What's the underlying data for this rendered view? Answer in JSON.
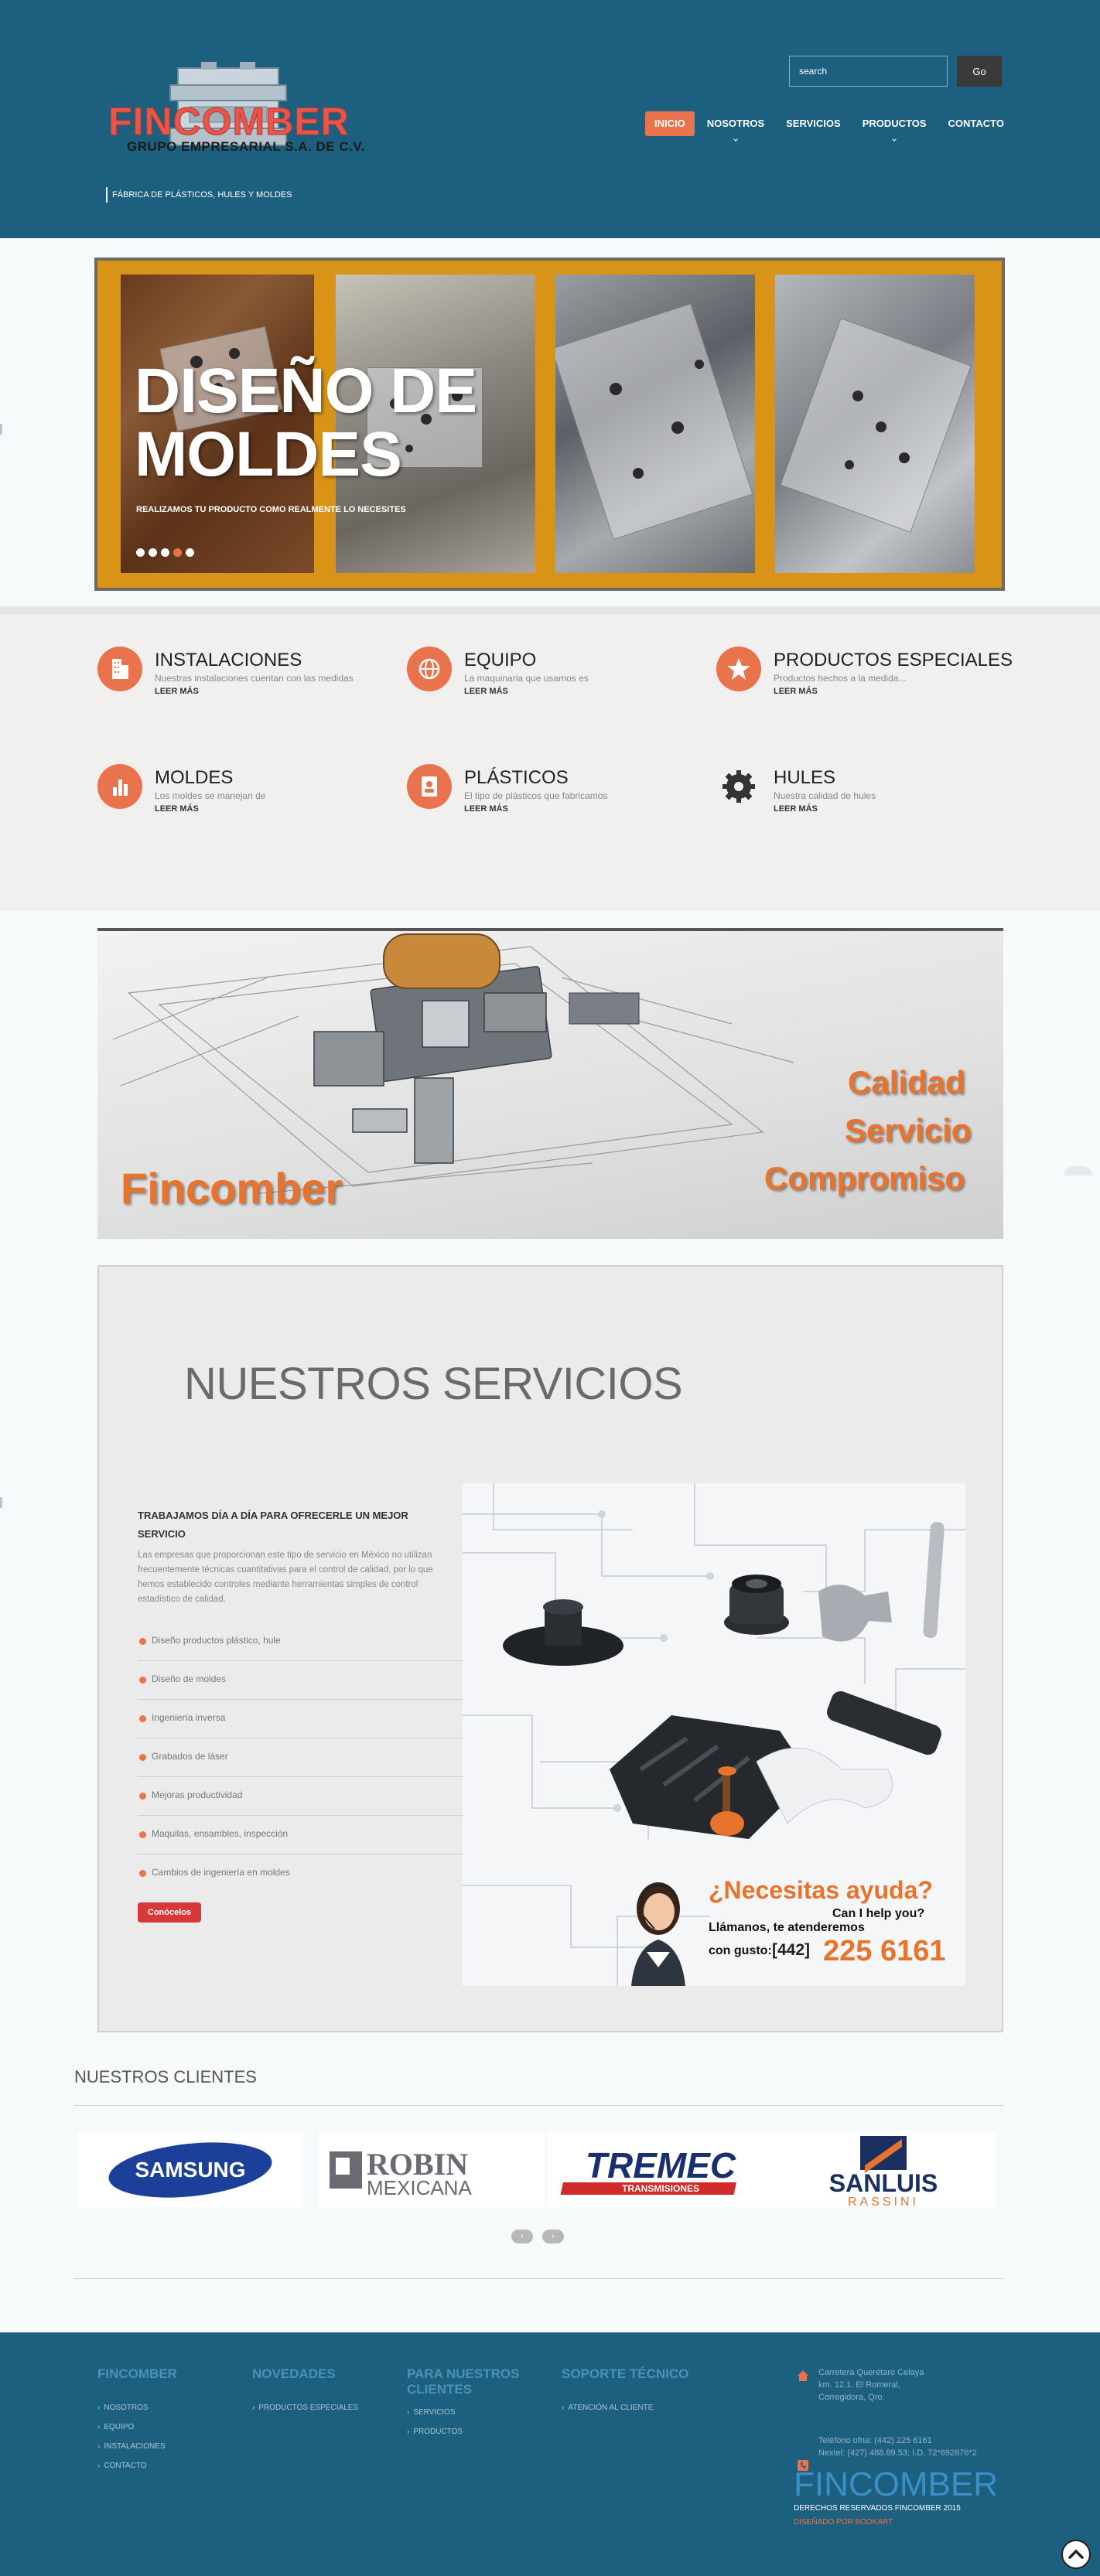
{
  "header": {
    "logo_text": "FINCOMBER",
    "logo_sub": "GRUPO EMPRESARIAL S.A. DE C.V.",
    "tagline": "FÁBRICA DE PLÁSTICOS, HULES Y MOLDES",
    "search": {
      "placeholder": "search",
      "value": "search"
    },
    "go_label": "Go",
    "nav": [
      {
        "label": "INICIO",
        "active": true
      },
      {
        "label": "NOSOTROS",
        "dropdown": true
      },
      {
        "label": "SERVICIOS"
      },
      {
        "label": "PRODUCTOS",
        "dropdown": true
      },
      {
        "label": "CONTACTO"
      }
    ]
  },
  "slider": {
    "title_line1": "DISEÑO DE",
    "title_line2": "MOLDES",
    "subtitle": "REALIZAMOS TU PRODUCTO COMO REALMENTE LO NECESITES",
    "dot_count": 5,
    "active_dot": 3
  },
  "features": [
    {
      "title": "INSTALACIONES",
      "desc": "Nuestras instalaciones cuentan con las medidas",
      "more": "LEER MÁS",
      "icon": "building-icon"
    },
    {
      "title": "EQUIPO",
      "desc": "La maquinaria que usamos es",
      "more": "LEER MÁS",
      "icon": "globe-icon"
    },
    {
      "title": "PRODUCTOS ESPECIALES",
      "desc": "Productos hechos a la medida...",
      "more": "LEER MÁS",
      "icon": "star-icon"
    },
    {
      "title": "MOLDES",
      "desc": "Los moldes se manejan de",
      "more": "LEER MÁS",
      "icon": "bar-chart-icon"
    },
    {
      "title": "PLÁSTICOS",
      "desc": "El tipo de plásticos que fabricamos",
      "more": "LEER MÁS",
      "icon": "address-book-icon"
    },
    {
      "title": "HULES",
      "desc": "Nuestra calidad de hules",
      "more": "LEER MÁS",
      "icon": "gear-icon"
    }
  ],
  "banner": {
    "brand": "Fincomber",
    "words": [
      "Calidad",
      "Servicio",
      "Compromiso"
    ]
  },
  "services": {
    "title": "NUESTROS SERVICIOS",
    "intro_head": "TRABAJAMOS DÍA A DÍA PARA OFRECERLE UN MEJOR SERVICIO",
    "intro": "Las empresas que proporcionan este tipo de servicio en México no utilizan frecuentemente técnicas cuantitativas para el control de calidad, por lo que hemos establecido controles mediante herramientas simples de control estadístico de calidad.",
    "items": [
      "Diseño productos plástico, hule",
      "Diseño de moldes",
      "Ingeniería inversa",
      "Grabados de láser",
      "Mejoras productividad",
      "Maquilas, ensambles, inspección",
      "Cambios de ingeniería en moldes"
    ],
    "button": "Conócelos",
    "ad": {
      "title": "¿Necesitas ayuda?",
      "english": "Can I help you?",
      "line1": "Llámanos, te atenderemos",
      "line2": "con gusto:",
      "code": "[442]",
      "number": "225 6161"
    }
  },
  "clients": {
    "title": "NUESTROS CLIENTES",
    "logos": [
      {
        "name": "SAMSUNG"
      },
      {
        "name": "ROBIN",
        "sub": "MEXICANA"
      },
      {
        "name": "TREMEC",
        "sub": "TRANSMISIONES"
      },
      {
        "name": "SANLUIS",
        "sub": "RASSINI"
      }
    ],
    "prev": "‹",
    "next": "›"
  },
  "footer": {
    "columns": [
      {
        "title": "FINCOMBER",
        "links": [
          "NOSOTROS",
          "EQUIPO",
          "INSTALACIONES",
          "CONTACTO"
        ]
      },
      {
        "title": "NOVEDADES",
        "links": [
          "PRODUCTOS ESPECIALES"
        ]
      },
      {
        "title": "PARA NUESTROS CLIENTES",
        "links": [
          "SERVICIOS",
          "PRODUCTOS"
        ]
      },
      {
        "title": "SOPORTE TÉCNICO",
        "links": [
          "ATENCIÓN AL CLIENTE"
        ]
      }
    ],
    "address": [
      "Carretera Querétaro Celaya",
      "km. 12.1. El Romeral,",
      "Corregidora, Qro."
    ],
    "phones": [
      "Teléfono ofna: (442) 225 6161",
      "Nextel: (427) 488.89.53; I.D. 72*692876*2"
    ],
    "brand": "FINCOMBER",
    "rights": "DERECHOS RESERVADOS FINCOMBER 2015",
    "design": "DISEÑADO POR BOOKART"
  },
  "colors": {
    "primary": "#1c5f7e",
    "accent": "#e8734c",
    "slider_frame": "#d99417",
    "button_red": "#d9383a"
  }
}
